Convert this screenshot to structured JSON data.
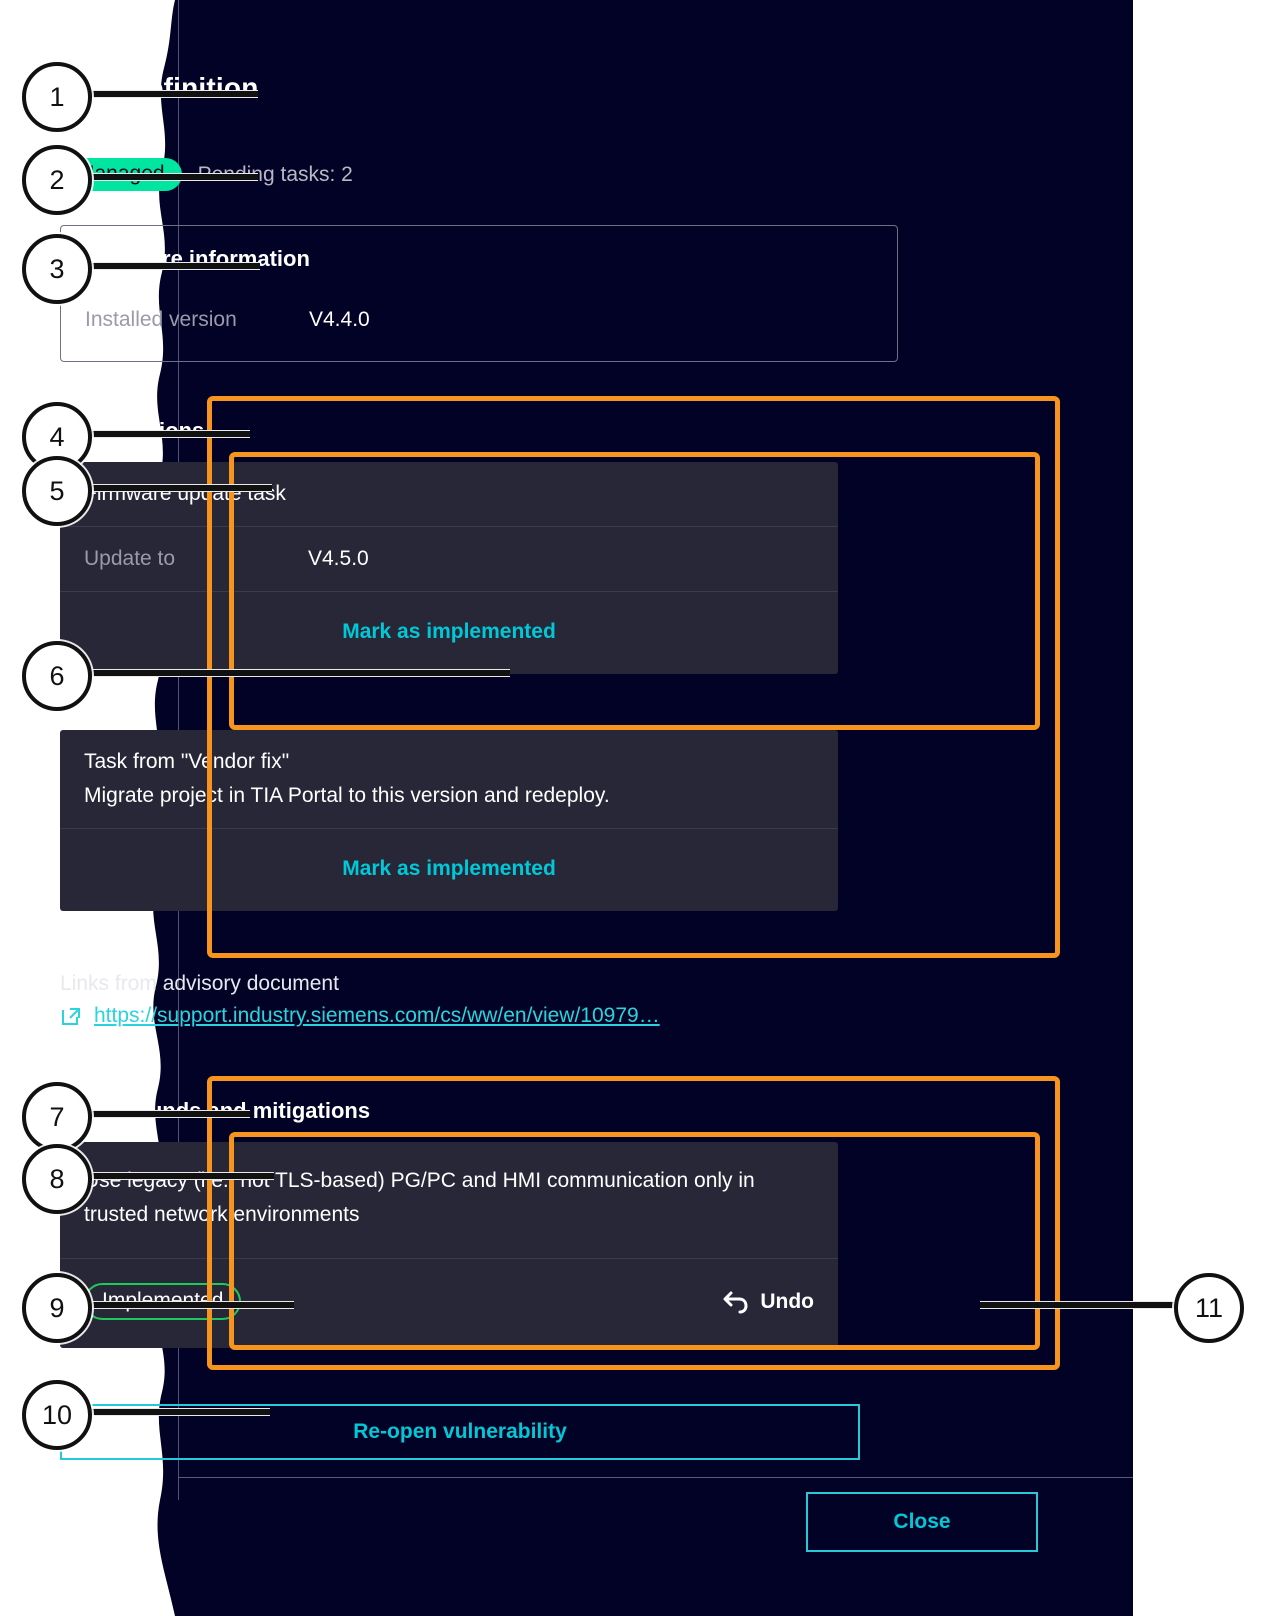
{
  "panel": {
    "title": "Task definition",
    "status": {
      "badge": "Managed",
      "pending": "Pending tasks: 2",
      "badge_color": "#00e6a0"
    },
    "firmware": {
      "heading": "Firmware information",
      "installed_label": "Installed version",
      "installed_value": "V4.4.0"
    },
    "remediations": {
      "heading": "Remediations",
      "cards": [
        {
          "title": "Firmware update task",
          "kv_label": "Update to",
          "kv_value": "V4.5.0",
          "action": "Mark as implemented"
        },
        {
          "title": "Task from \"Vendor fix\"",
          "body": "Migrate project in TIA Portal to this version and redeploy.",
          "action": "Mark as implemented"
        }
      ]
    },
    "links": {
      "label": "Links from advisory document",
      "icon": "external-link-icon",
      "url": "https://support.industry.siemens.com/cs/ww/en/view/10979…"
    },
    "workarounds": {
      "heading": "Workarounds and mitigations",
      "card": {
        "body": "Use legacy (i.e., not TLS-based) PG/PC and HMI communication only in trusted network environments",
        "status_pill": "Implemented",
        "status_pill_color": "#1fc85a",
        "undo_label": "Undo",
        "undo_icon": "undo-arrow-icon"
      }
    },
    "reopen_button": "Re-open vulnerability",
    "close_button": "Close",
    "accent_color": "#00c8d7",
    "annotation_color": "#f7941e"
  },
  "callouts": [
    {
      "number": "1",
      "side": "left"
    },
    {
      "number": "2",
      "side": "left"
    },
    {
      "number": "3",
      "side": "left"
    },
    {
      "number": "4",
      "side": "left"
    },
    {
      "number": "5",
      "side": "left"
    },
    {
      "number": "6",
      "side": "left"
    },
    {
      "number": "7",
      "side": "left"
    },
    {
      "number": "8",
      "side": "left"
    },
    {
      "number": "9",
      "side": "left"
    },
    {
      "number": "10",
      "side": "left"
    },
    {
      "number": "11",
      "side": "right"
    }
  ]
}
